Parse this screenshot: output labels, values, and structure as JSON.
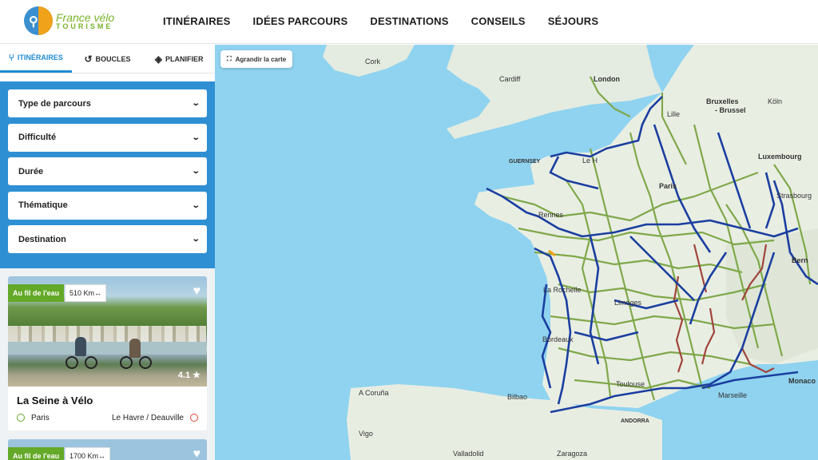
{
  "brand": {
    "line1": "France",
    "line1b": "vélo",
    "line2": "TOURISME"
  },
  "nav": [
    "ITINÉRAIRES",
    "IDÉES PARCOURS",
    "DESTINATIONS",
    "CONSEILS",
    "SÉJOURS"
  ],
  "tabs": [
    {
      "label": "ITINÉRAIRES",
      "icon": "route-icon"
    },
    {
      "label": "BOUCLES",
      "icon": "loop-icon"
    },
    {
      "label": "PLANIFIER",
      "icon": "directions-icon"
    }
  ],
  "filters": [
    "Type de parcours",
    "Difficulté",
    "Durée",
    "Thématique",
    "Destination"
  ],
  "cards": [
    {
      "badge": "Au fil de l'eau",
      "distance": "510 Km",
      "rating": "4.1",
      "title": "La Seine à Vélo",
      "start": "Paris",
      "end": "Le Havre / Deauville"
    },
    {
      "badge": "Au fil de l'eau",
      "distance": "1700 Km"
    }
  ],
  "map": {
    "enlarge_label": "Agrandir la carte",
    "labels": {
      "cork": "Cork",
      "cardiff": "Cardiff",
      "london": "London",
      "bruxelles1": "Bruxelles",
      "bruxelles2": "- Brussel",
      "koln": "Köln",
      "lille": "Lille",
      "guernsey": "GUERNSEY",
      "lehavre": "Le H",
      "luxembourg": "Luxembourg",
      "paris": "Paris",
      "strasbourg": "Strasbourg",
      "rennes": "Rennes",
      "bern": "Bern",
      "larochelle": "La Rochelle",
      "limoges": "Limoges",
      "bordeaux": "Bordeaux",
      "acoruna": "A Coruña",
      "bilbao": "Bilbao",
      "toulouse": "Toulouse",
      "marseille": "Marseille",
      "monaco": "Monaco",
      "andorra": "ANDORRA",
      "vigo": "Vigo",
      "valladolid": "Valladolid",
      "zaragoza": "Zaragoza"
    }
  },
  "colors": {
    "accent": "#1f8bd4",
    "green": "#64a928",
    "sea": "#8fd3f0",
    "route_blue": "#1b3fa0",
    "route_green": "#7fa84a",
    "route_red": "#a0453c"
  }
}
